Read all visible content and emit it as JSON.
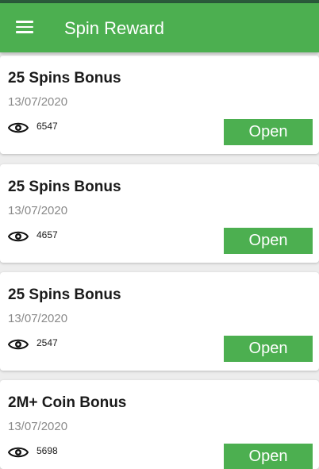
{
  "app_bar": {
    "title": "Spin Reward",
    "menu_icon": "hamburger-menu-icon",
    "color": "#4caf50"
  },
  "rewards": [
    {
      "title": "25 Spins Bonus",
      "date": "13/07/2020",
      "views": "6547",
      "button_label": "Open"
    },
    {
      "title": "25 Spins Bonus",
      "date": "13/07/2020",
      "views": "4657",
      "button_label": "Open"
    },
    {
      "title": "25 Spins Bonus",
      "date": "13/07/2020",
      "views": "2547",
      "button_label": "Open"
    },
    {
      "title": "2M+ Coin Bonus",
      "date": "13/07/2020",
      "views": "5698",
      "button_label": "Open"
    }
  ],
  "views_icon": "eye-icon",
  "accent_color": "#4caf50"
}
